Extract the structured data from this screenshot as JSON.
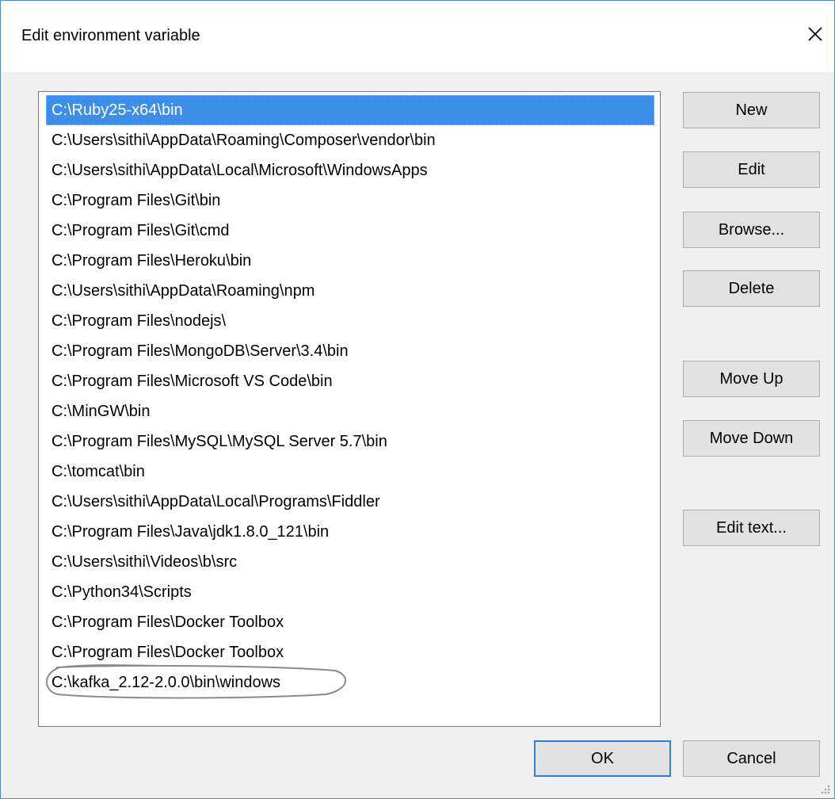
{
  "dialog": {
    "title": "Edit environment variable",
    "close_icon": "close-icon"
  },
  "list": {
    "items": [
      {
        "text": "C:\\Ruby25-x64\\bin",
        "selected": true
      },
      {
        "text": "C:\\Users\\sithi\\AppData\\Roaming\\Composer\\vendor\\bin"
      },
      {
        "text": "C:\\Users\\sithi\\AppData\\Local\\Microsoft\\WindowsApps"
      },
      {
        "text": "C:\\Program Files\\Git\\bin"
      },
      {
        "text": "C:\\Program Files\\Git\\cmd"
      },
      {
        "text": "C:\\Program Files\\Heroku\\bin"
      },
      {
        "text": "C:\\Users\\sithi\\AppData\\Roaming\\npm"
      },
      {
        "text": "C:\\Program Files\\nodejs\\"
      },
      {
        "text": "C:\\Program Files\\MongoDB\\Server\\3.4\\bin"
      },
      {
        "text": "C:\\Program Files\\Microsoft VS Code\\bin"
      },
      {
        "text": "C:\\MinGW\\bin"
      },
      {
        "text": "C:\\Program Files\\MySQL\\MySQL Server 5.7\\bin"
      },
      {
        "text": "C:\\tomcat\\bin"
      },
      {
        "text": "C:\\Users\\sithi\\AppData\\Local\\Programs\\Fiddler"
      },
      {
        "text": "C:\\Program Files\\Java\\jdk1.8.0_121\\bin"
      },
      {
        "text": "C:\\Users\\sithi\\Videos\\b\\src"
      },
      {
        "text": "C:\\Python34\\Scripts"
      },
      {
        "text": "C:\\Program Files\\Docker Toolbox"
      },
      {
        "text": "C:\\Program Files\\Docker Toolbox"
      },
      {
        "text": "C:\\kafka_2.12-2.0.0\\bin\\windows",
        "annotated": true
      }
    ]
  },
  "buttons": {
    "new": "New",
    "edit": "Edit",
    "browse": "Browse...",
    "delete": "Delete",
    "move_up": "Move Up",
    "move_down": "Move Down",
    "edit_text": "Edit text...",
    "ok": "OK",
    "cancel": "Cancel"
  },
  "colors": {
    "selection": "#3d8ee8",
    "window_border": "#4a8ad0",
    "client_bg": "#f0f0f0",
    "button_bg": "#e1e1e1",
    "default_button_border": "#2f7ed8"
  }
}
